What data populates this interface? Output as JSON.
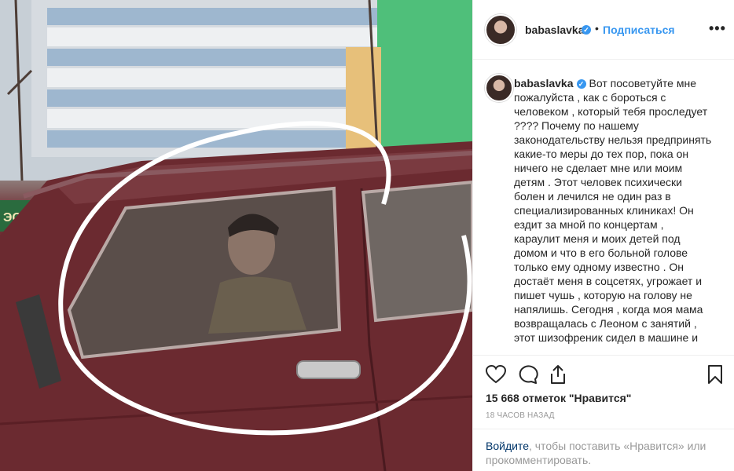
{
  "post": {
    "username": "babaslavka",
    "verified_mark": "✓",
    "separator": "•",
    "follow_label": "Подписаться",
    "more_label": "•••",
    "caption": "Вот посоветуйте мне пожалуйста , как с бороться с человеком , который тебя проследует ???? Почему по нашему законодательству нельзя предпринять какие-то меры до тех пор, пока он ничего не сделает мне или моим детям . Этот человек психически болен и лечился не один раз в специализированных клиниках! Он ездит за мной по концертам , караулит меня и моих детей под домом и что в его больной голове только ему одному известно . Он достаёт меня в соцсетях, угрожает и пишет чушь , которую на голову не напялишь. Сегодня , когда моя мама возвращалась с Леоном с занятий , этот шизофреник сидел в машине и",
    "likes_text": "15 668 отметок \"Нравится\"",
    "time_text": "18 ЧАСОВ НАЗАД",
    "login_link": "Войдите",
    "login_rest": ", чтобы поставить «Нравится» или прокомментировать.",
    "photo_sign": "ЭОІТ"
  },
  "icons": {
    "like": "heart-icon",
    "comment": "comment-icon",
    "share": "share-icon",
    "save": "bookmark-icon",
    "avatar": "avatar"
  },
  "colors": {
    "link_blue": "#3897f0",
    "login_link": "#003569",
    "muted": "#999999",
    "car_red": "#6b2a30"
  }
}
